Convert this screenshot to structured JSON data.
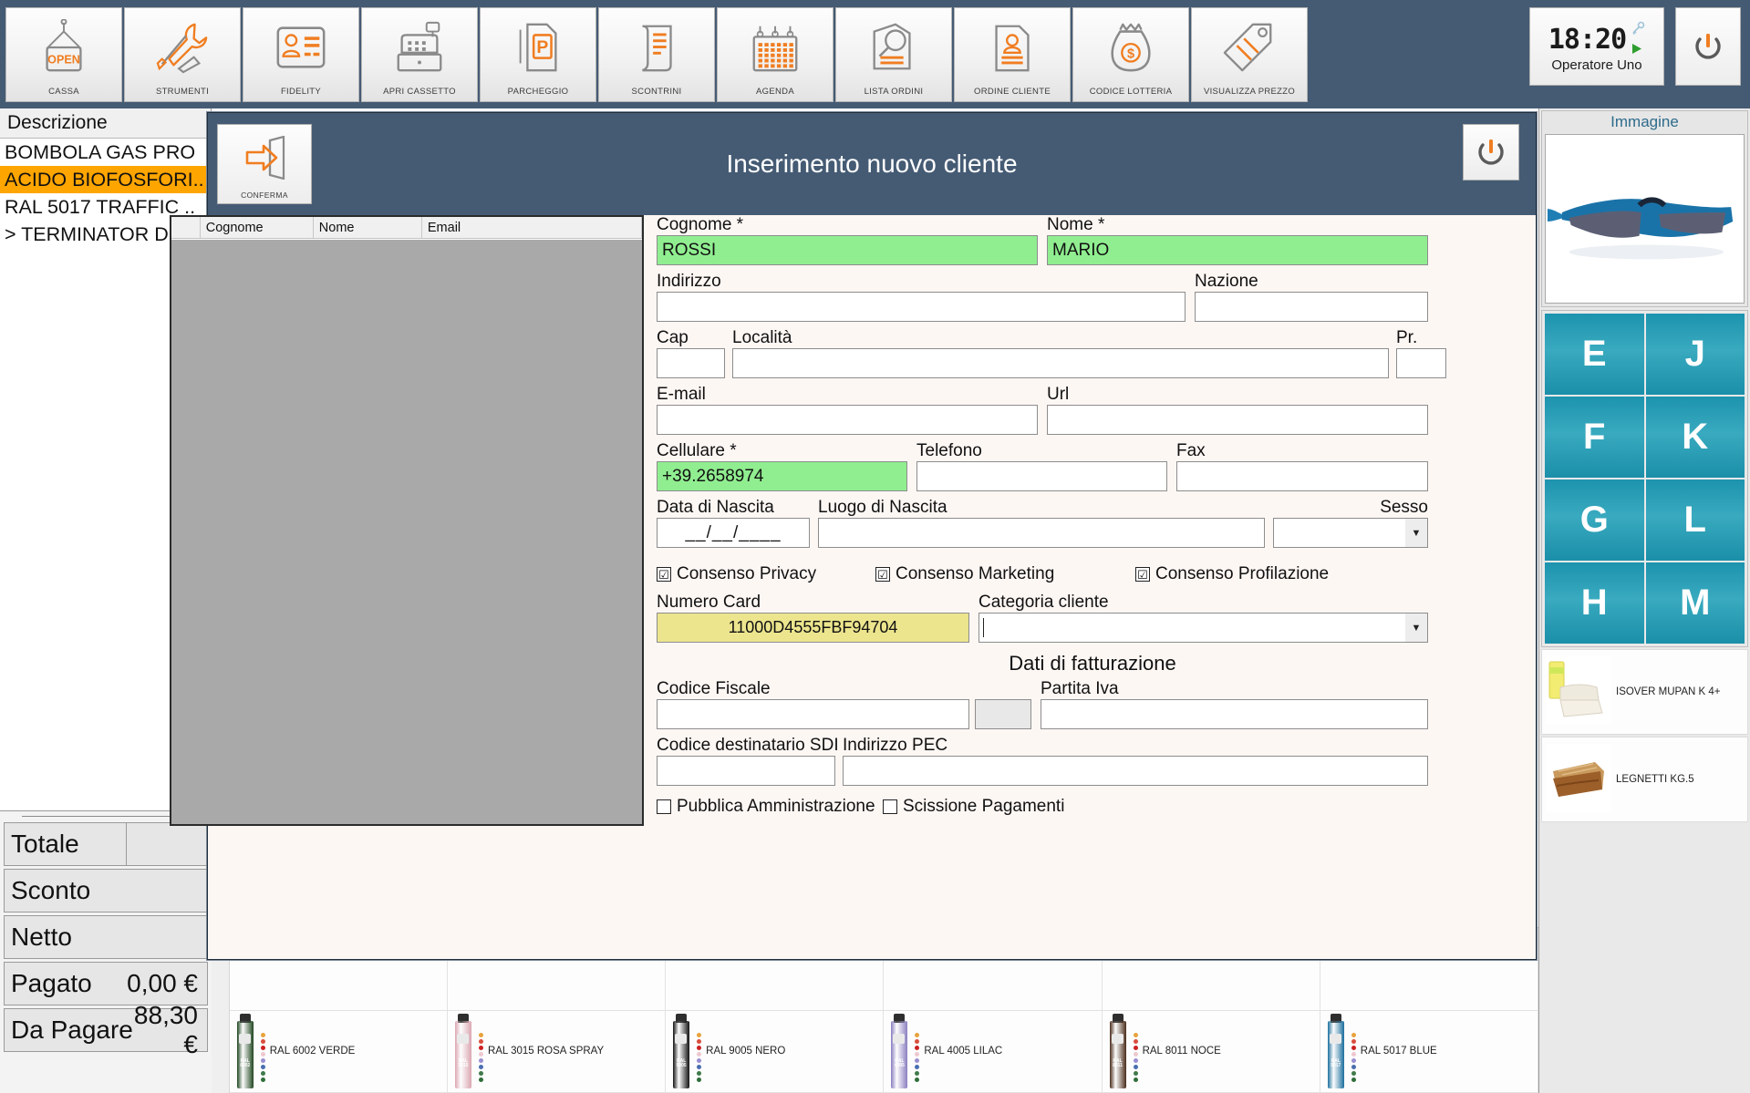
{
  "toolbar": {
    "buttons": [
      {
        "label": "CASSA",
        "icon": "open-sign-icon"
      },
      {
        "label": "STRUMENTI",
        "icon": "tools-icon"
      },
      {
        "label": "FIDELITY",
        "icon": "id-card-icon"
      },
      {
        "label": "APRI CASSETTO",
        "icon": "cash-register-icon"
      },
      {
        "label": "PARCHEGGIO",
        "icon": "parking-icon"
      },
      {
        "label": "SCONTRINI",
        "icon": "receipt-icon"
      },
      {
        "label": "AGENDA",
        "icon": "calendar-icon"
      },
      {
        "label": "LISTA ORDINI",
        "icon": "order-search-icon"
      },
      {
        "label": "ORDINE CLIENTE",
        "icon": "customer-order-icon"
      },
      {
        "label": "CODICE LOTTERIA",
        "icon": "money-bag-icon"
      },
      {
        "label": "VISUALIZZA PREZZO",
        "icon": "price-tag-icon"
      }
    ],
    "clock": "18:20",
    "operator": "Operatore Uno",
    "key_icon": "key-icon",
    "play_icon": "play-icon",
    "power_icon": "power-icon"
  },
  "left_panel": {
    "header": "Descrizione",
    "items": [
      {
        "text": "BOMBOLA GAS PRO",
        "selected": false
      },
      {
        "text": "ACIDO BIOFOSFORI..",
        "selected": true
      },
      {
        "text": "RAL 5017 TRAFFIC ..",
        "selected": false
      },
      {
        "text": "> TERMINATOR DIO.",
        "selected": false
      }
    ]
  },
  "totals": {
    "rows": [
      {
        "label": "Totale",
        "value": "",
        "split": true
      },
      {
        "label": "Sconto",
        "value": "",
        "split": false
      },
      {
        "label": "Netto",
        "value": "",
        "split": false
      },
      {
        "label": "Pagato",
        "value": "0,00 €",
        "split": false
      },
      {
        "label": "Da Pagare",
        "value": "88,30 €",
        "split": false
      }
    ]
  },
  "modal": {
    "title": "Inserimento nuovo cliente",
    "confirm_label": "CONFERMA",
    "confirm_icon": "exit-arrow-icon",
    "close_icon": "power-icon",
    "list": {
      "columns": [
        "Cognome",
        "Nome",
        "Email"
      ],
      "rows": []
    },
    "form": {
      "cognome": {
        "label": "Cognome *",
        "value": "ROSSI",
        "state": "green"
      },
      "nome": {
        "label": "Nome *",
        "value": "MARIO",
        "state": "green"
      },
      "indirizzo": {
        "label": "Indirizzo",
        "value": ""
      },
      "nazione": {
        "label": "Nazione",
        "value": ""
      },
      "cap": {
        "label": "Cap",
        "value": ""
      },
      "localita": {
        "label": "Località",
        "value": ""
      },
      "pr": {
        "label": "Pr.",
        "value": ""
      },
      "email": {
        "label": "E-mail",
        "value": ""
      },
      "url": {
        "label": "Url",
        "value": ""
      },
      "cellulare": {
        "label": "Cellulare *",
        "value": "+39.2658974",
        "state": "green"
      },
      "telefono": {
        "label": "Telefono",
        "value": ""
      },
      "fax": {
        "label": "Fax",
        "value": ""
      },
      "data_nascita": {
        "label": "Data di Nascita",
        "value": "__/__/____"
      },
      "luogo_nascita": {
        "label": "Luogo di Nascita",
        "value": ""
      },
      "sesso": {
        "label": "Sesso",
        "value": ""
      },
      "consenso_privacy": {
        "label": "Consenso Privacy",
        "checked": true
      },
      "consenso_marketing": {
        "label": "Consenso Marketing",
        "checked": true
      },
      "consenso_profilazione": {
        "label": "Consenso Profilazione",
        "checked": true
      },
      "numero_card": {
        "label": "Numero Card",
        "value": "11000D4555FBF94704",
        "state": "yellow"
      },
      "categoria_cliente": {
        "label": "Categoria cliente",
        "value": ""
      },
      "fatturazione_title": "Dati di fatturazione",
      "codice_fiscale": {
        "label": "Codice Fiscale",
        "value": ""
      },
      "partita_iva": {
        "label": "Partita Iva",
        "value": ""
      },
      "codice_sdi": {
        "label": "Codice destinatario SDI",
        "value": ""
      },
      "indirizzo_pec": {
        "label": "Indirizzo PEC",
        "value": ""
      },
      "pubblica_amministrazione": {
        "label": "Pubblica Amministrazione",
        "checked": false
      },
      "scissione_pagamenti": {
        "label": "Scissione Pagamenti",
        "checked": false
      }
    }
  },
  "right_panel": {
    "image_caption": "Immagine",
    "image_alt": "sunglasses-photo",
    "keys": [
      [
        "E",
        "J"
      ],
      [
        "F",
        "K"
      ],
      [
        "G",
        "L"
      ],
      [
        "H",
        "M"
      ]
    ],
    "products": [
      {
        "name": "ISOVER MUPAN K 4+",
        "thumb": "insulation-roll-photo"
      },
      {
        "name": "LEGNETTI KG.5",
        "thumb": "firewood-photo"
      }
    ]
  },
  "product_strip": {
    "items": [
      {
        "name": "RAL 6002 VERDE",
        "color": "#1f4620"
      },
      {
        "name": "RAL 3015 ROSA SPRAY",
        "color": "#dba6b1"
      },
      {
        "name": "RAL 9005 NERO",
        "color": "#111111"
      },
      {
        "name": "RAL 4005 LILAC",
        "color": "#8a7ec0"
      },
      {
        "name": "RAL 8011 NOCE",
        "color": "#4a2c1a"
      },
      {
        "name": "RAL 5017 BLUE",
        "color": "#1b6e9e"
      }
    ],
    "dot_colors": [
      "#e8a33d",
      "#d94f3d",
      "#cc2222",
      "#edc8cf",
      "#9a8fd0",
      "#4a6fb0",
      "#3f7a4a",
      "#2f6e3a"
    ]
  },
  "colors": {
    "accent_blue": "#455b74",
    "accent_orange": "#f07d20",
    "selection_orange": "#ffa500",
    "valid_green": "#90ee90",
    "card_yellow": "#ece58e",
    "key_teal": "#1d93ae"
  }
}
